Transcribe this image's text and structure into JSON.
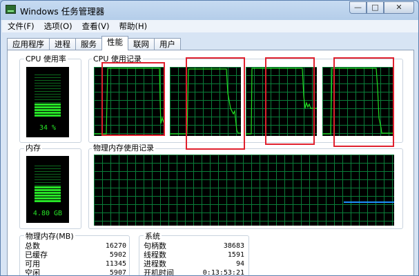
{
  "window": {
    "title": "Windows 任务管理器",
    "min_glyph": "—",
    "max_glyph": "□",
    "close_glyph": "✕"
  },
  "menu": [
    "文件(F)",
    "选项(O)",
    "查看(V)",
    "帮助(H)"
  ],
  "tabs": [
    {
      "label": "应用程序",
      "active": false
    },
    {
      "label": "进程",
      "active": false
    },
    {
      "label": "服务",
      "active": false
    },
    {
      "label": "性能",
      "active": true
    },
    {
      "label": "联网",
      "active": false
    },
    {
      "label": "用户",
      "active": false
    }
  ],
  "cpu_usage": {
    "label": "CPU 使用率",
    "readout": "34 %",
    "level": 0.34
  },
  "cpu_history": {
    "label": "CPU 使用记录",
    "core_count": 4
  },
  "memory": {
    "label": "内存",
    "readout": "4.80 GB",
    "level": 0.4
  },
  "memory_history": {
    "label": "物理内存使用记录"
  },
  "physical_memory": {
    "label": "物理内存(MB)",
    "rows": [
      {
        "k": "总数",
        "v": "16270"
      },
      {
        "k": "已缓存",
        "v": "5902"
      },
      {
        "k": "可用",
        "v": "11345"
      },
      {
        "k": "空闲",
        "v": "5907"
      }
    ]
  },
  "system": {
    "label": "系统",
    "rows": [
      {
        "k": "句柄数",
        "v": "38683"
      },
      {
        "k": "线程数",
        "v": "1591"
      },
      {
        "k": "进程数",
        "v": "94"
      },
      {
        "k": "开机时间",
        "v": "0:13:53:21"
      }
    ]
  },
  "colors": {
    "graph_line": "#22e022",
    "grid": "#0a7e39",
    "highlight": "#e0202d",
    "memory_line": "#1e90ff"
  }
}
